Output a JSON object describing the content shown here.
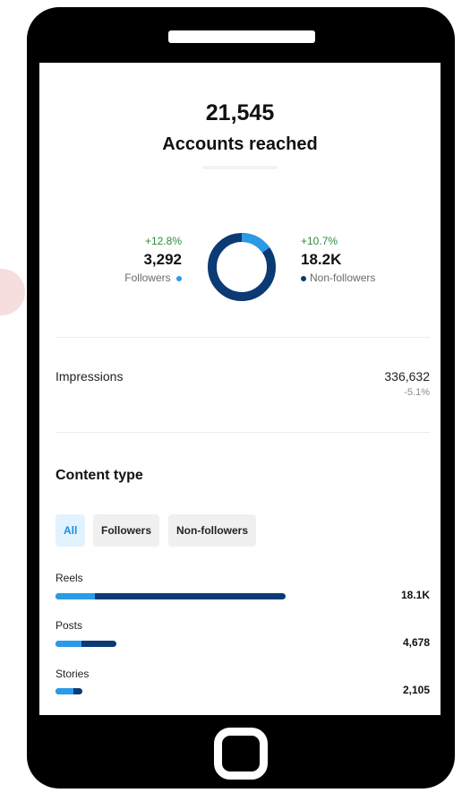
{
  "reach": {
    "total": "21,545",
    "label": "Accounts reached"
  },
  "followers": {
    "change": "+12.8%",
    "value": "3,292",
    "label": "Followers",
    "share": 0.153
  },
  "non_followers": {
    "change": "+10.7%",
    "value": "18.2K",
    "label": "Non-followers",
    "share": 0.847
  },
  "impressions": {
    "label": "Impressions",
    "value": "336,632",
    "change": "-5.1%"
  },
  "content_type": {
    "title": "Content type",
    "tabs": [
      "All",
      "Followers",
      "Non-followers"
    ],
    "active_tab": "All",
    "items": [
      {
        "label": "Reels",
        "value": "18.1K",
        "fraction": 1.0,
        "follower_fraction": 0.17
      },
      {
        "label": "Posts",
        "value": "4,678",
        "fraction": 0.265,
        "follower_fraction": 0.43
      },
      {
        "label": "Stories",
        "value": "2,105",
        "fraction": 0.117,
        "follower_fraction": 0.65
      }
    ]
  },
  "colors": {
    "followers": "#2a9be6",
    "non_followers": "#0b3a75",
    "positive": "#2e8b3e",
    "active_tab_bg": "#e3f2ff"
  }
}
